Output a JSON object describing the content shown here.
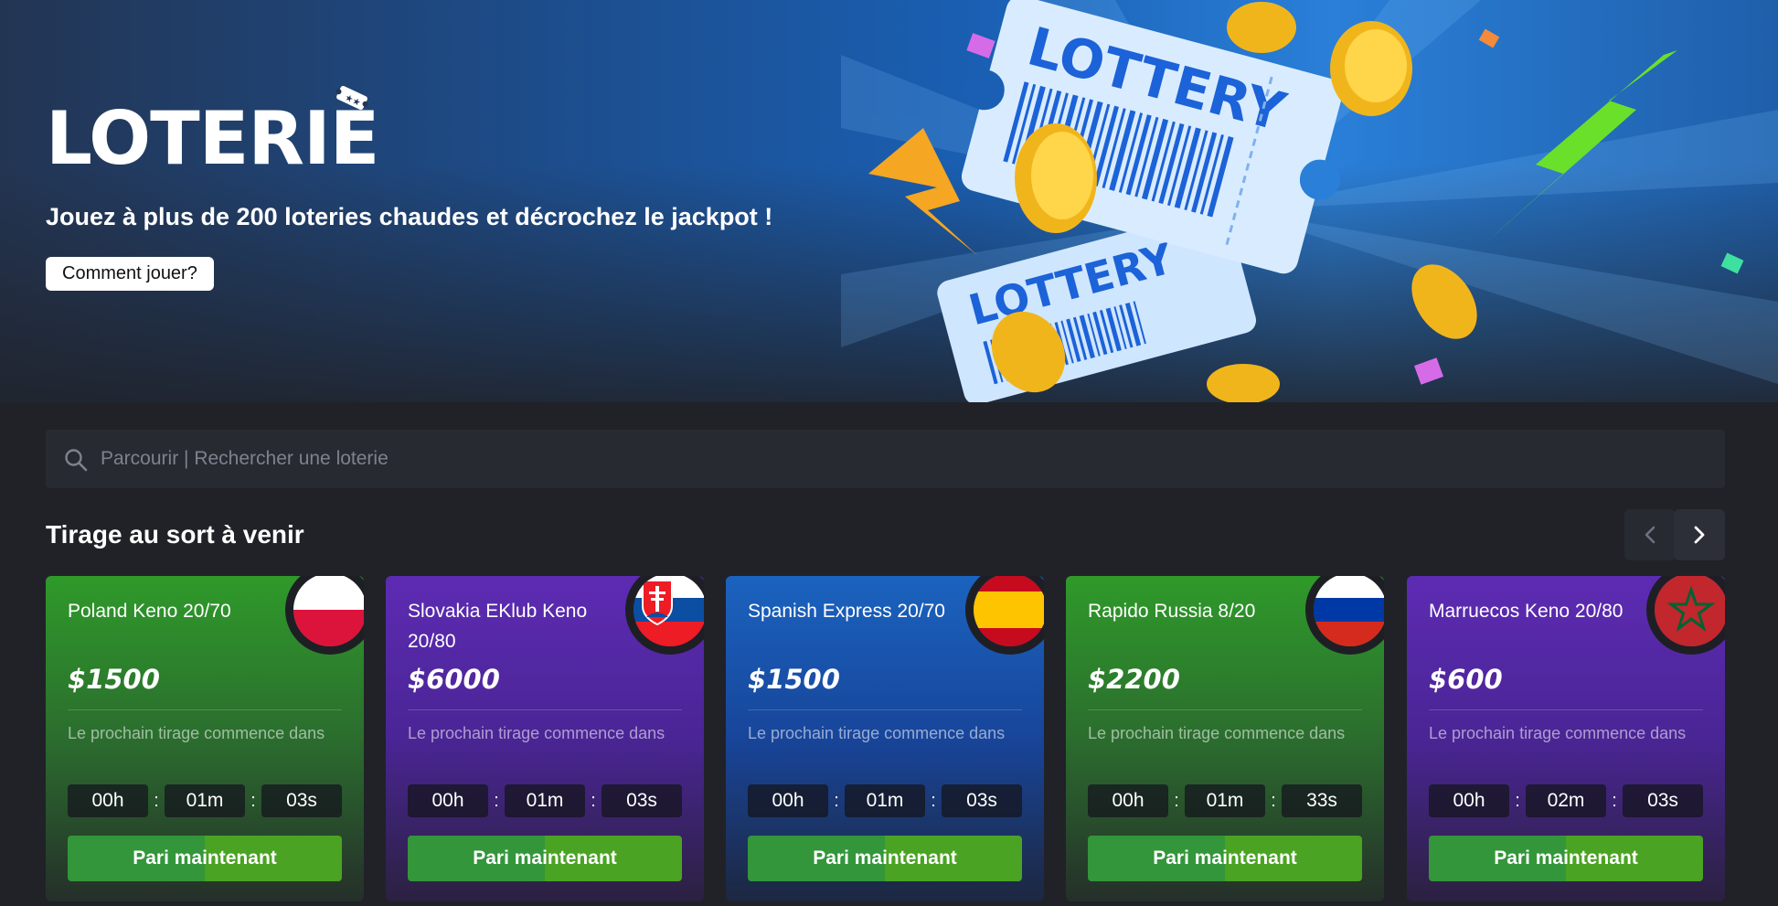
{
  "hero": {
    "title": "LOTERIE",
    "subtitle": "Jouez à plus de 200 loteries chaudes et décrochez le jackpot !",
    "how_to_play": "Comment jouer?",
    "art_ticket_text_1": "LOTTERY",
    "art_ticket_text_2": "LOTTERY"
  },
  "search": {
    "placeholder": "Parcourir | Rechercher une loterie"
  },
  "upcoming": {
    "title": "Tirage au sort à venir"
  },
  "cards": [
    {
      "name": "Poland Keno 20/70",
      "prize": "$1500",
      "next_label": "Le prochain tirage commence dans",
      "hours": "00h",
      "minutes": "01m",
      "seconds": "03s",
      "bet_label": "Pari maintenant",
      "flag": "poland-flag-icon",
      "theme": "green"
    },
    {
      "name": "Slovakia EKlub Keno 20/80",
      "prize": "$6000",
      "next_label": "Le prochain tirage commence dans",
      "hours": "00h",
      "minutes": "01m",
      "seconds": "03s",
      "bet_label": "Pari maintenant",
      "flag": "slovakia-flag-icon",
      "theme": "purple"
    },
    {
      "name": "Spanish Express 20/70",
      "prize": "$1500",
      "next_label": "Le prochain tirage commence dans",
      "hours": "00h",
      "minutes": "01m",
      "seconds": "03s",
      "bet_label": "Pari maintenant",
      "flag": "spain-flag-icon",
      "theme": "blue"
    },
    {
      "name": "Rapido Russia 8/20",
      "prize": "$2200",
      "next_label": "Le prochain tirage commence dans",
      "hours": "00h",
      "minutes": "01m",
      "seconds": "33s",
      "bet_label": "Pari maintenant",
      "flag": "russia-flag-icon",
      "theme": "green"
    },
    {
      "name": "Marruecos Keno 20/80",
      "prize": "$600",
      "next_label": "Le prochain tirage commence dans",
      "hours": "00h",
      "minutes": "02m",
      "seconds": "03s",
      "bet_label": "Pari maintenant",
      "flag": "morocco-flag-icon",
      "theme": "purple"
    }
  ],
  "colors": {
    "page_bg": "#202228",
    "green_card": "#2f9a2a",
    "purple_card": "#5d2bb3",
    "blue_card": "#1a63bf",
    "bet_button": "#4aa322"
  }
}
